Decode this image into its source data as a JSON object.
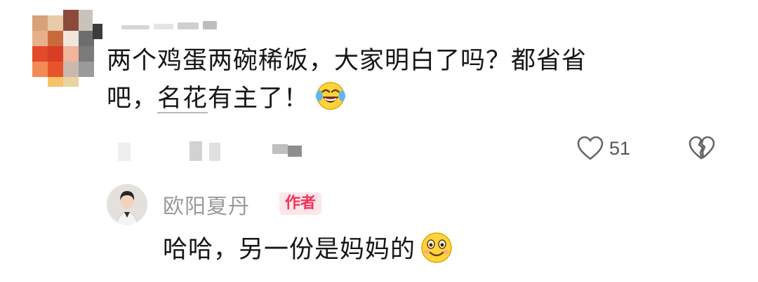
{
  "comment": {
    "author_avatar": "pixelated-avatar",
    "line1": "两个鸡蛋两碗稀饭，大家明白了吗？都省省",
    "line2_pre": "吧，",
    "line2_underlined": "名花",
    "line2_post": "有主了！",
    "emoji": "laughing-tears-emoji",
    "like_count": "51"
  },
  "reply": {
    "author_name": "欧阳夏丹",
    "badge": "作者",
    "text": "哈哈，另一份是妈妈的",
    "emoji": "smiling-emoji"
  },
  "colors": {
    "badge_bg": "#fde6ea",
    "badge_text": "#f0345a",
    "name_gray": "#9a9a9a"
  }
}
